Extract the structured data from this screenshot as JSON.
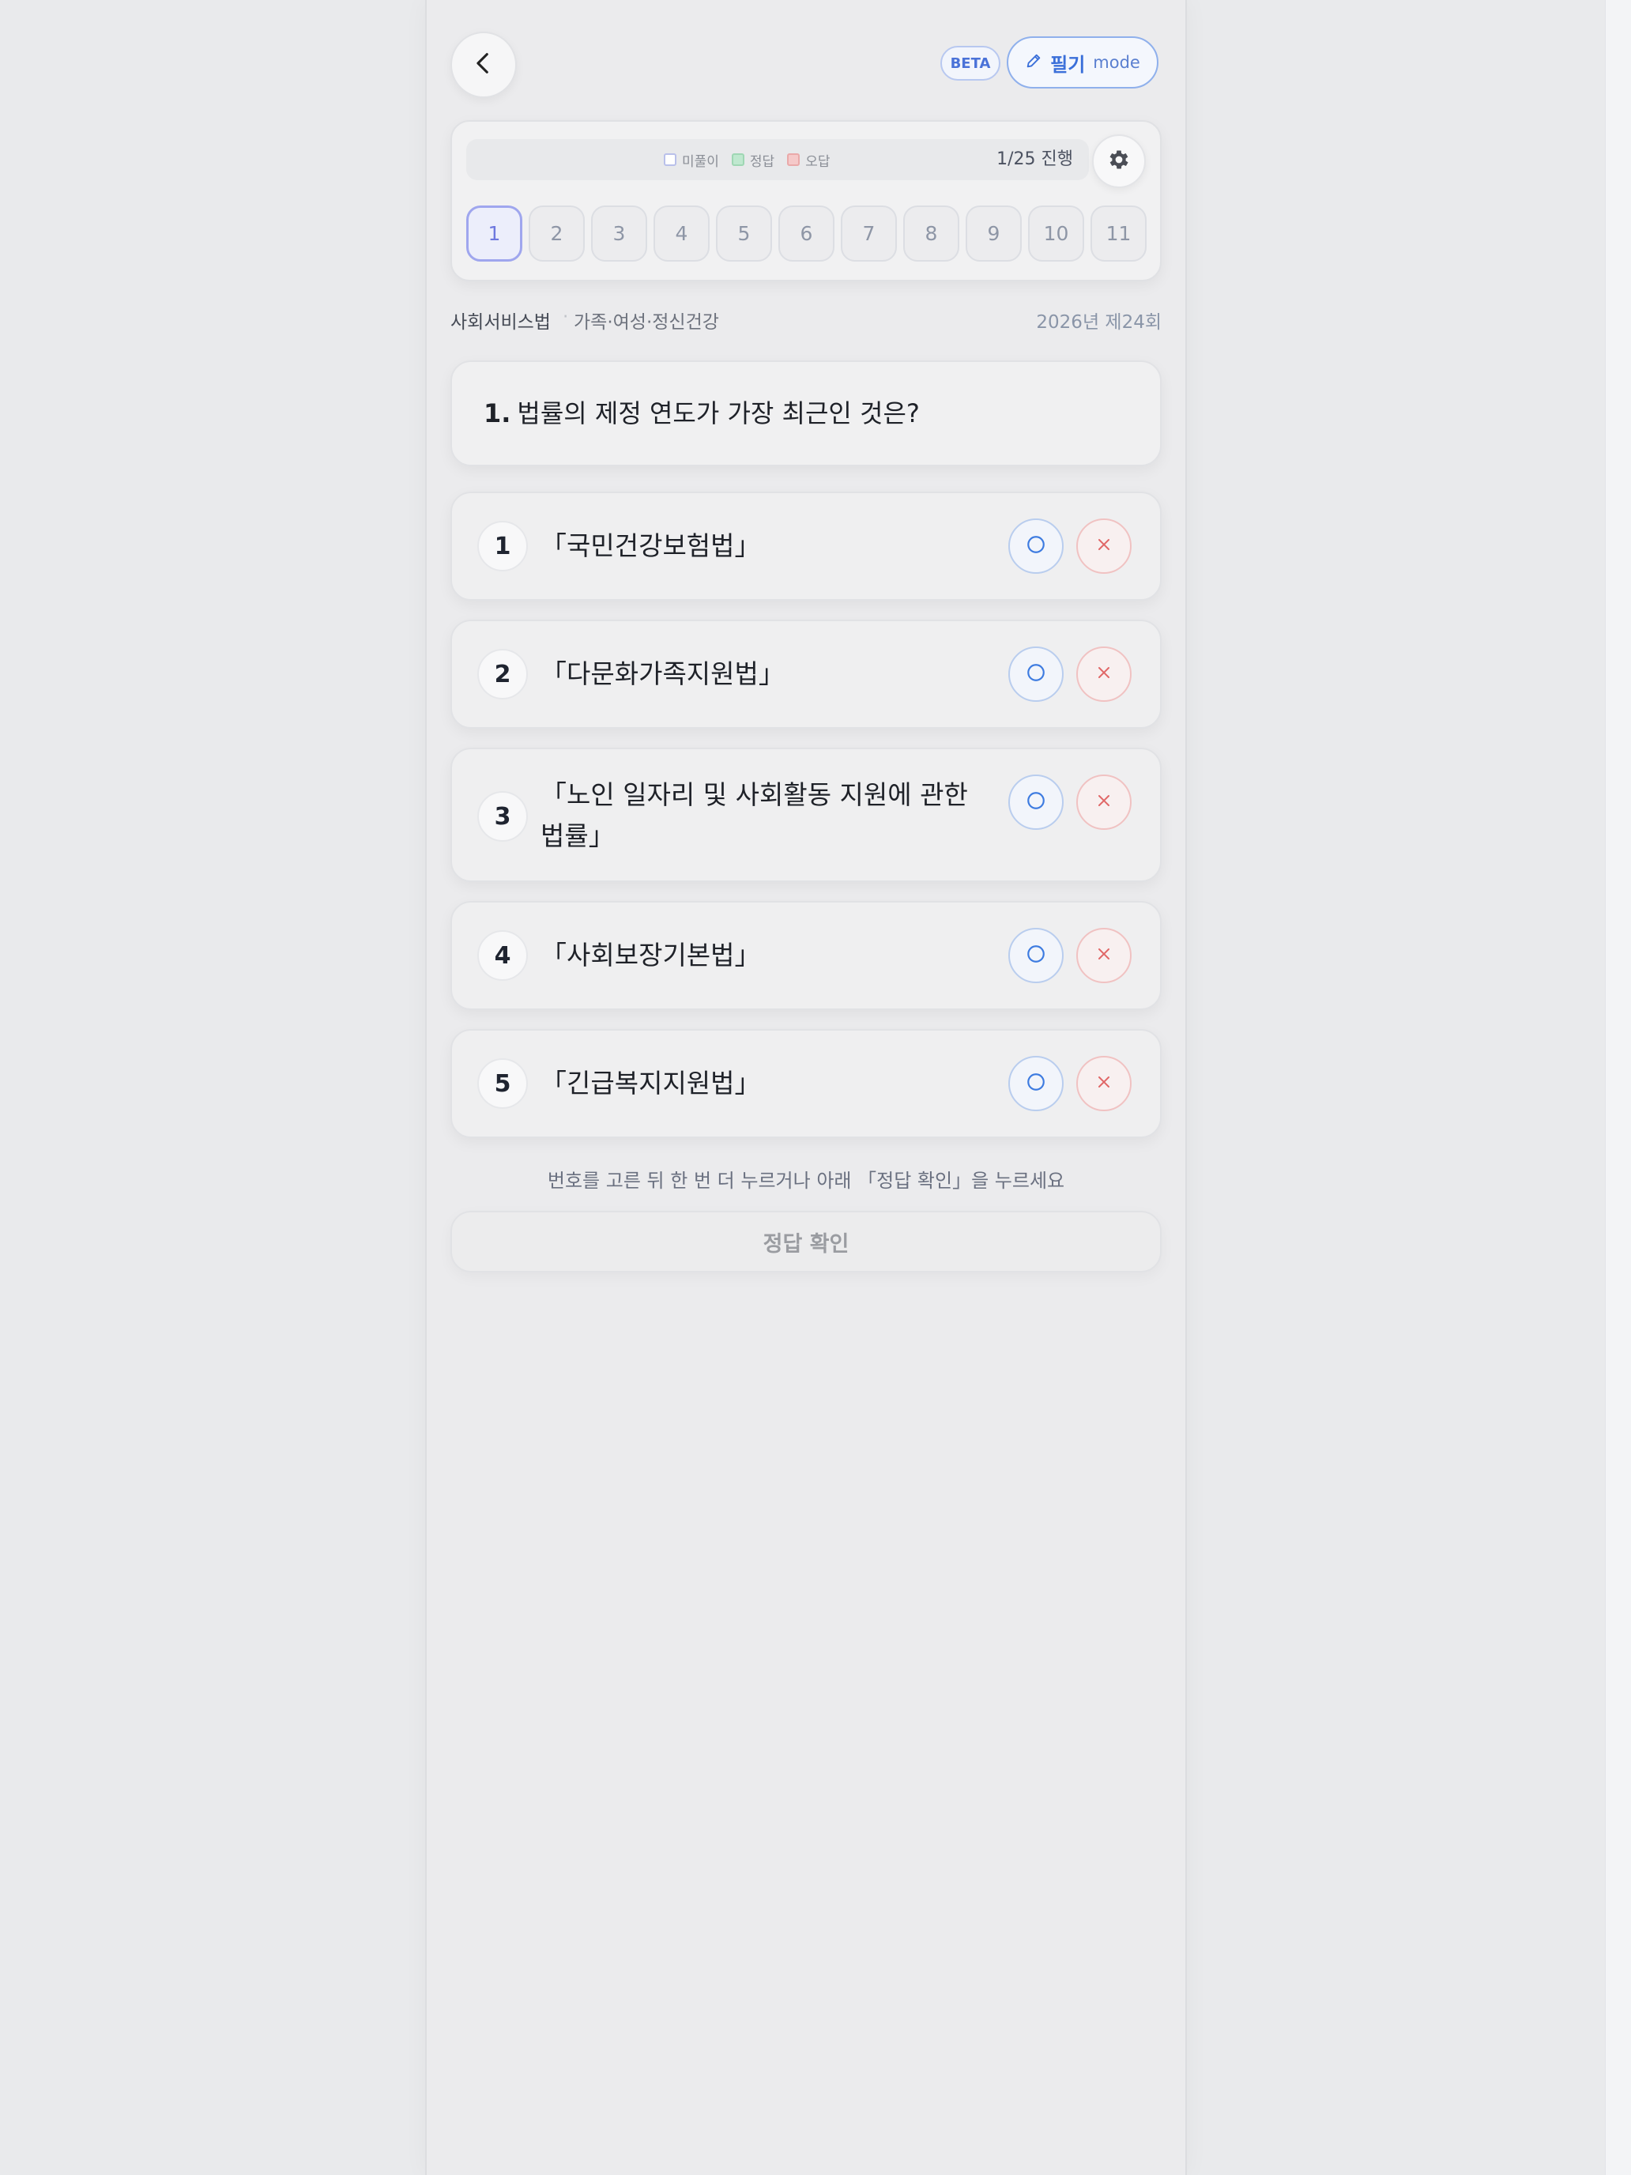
{
  "header": {
    "beta_label": "BETA",
    "mode_label": "필기",
    "mode_suffix": "mode"
  },
  "progress": {
    "legend": [
      {
        "label": "미풀이",
        "color": "#ffffff",
        "border": "#b9c0ea"
      },
      {
        "label": "정답",
        "color": "#bfe8cf",
        "border": "#9fd7b4"
      },
      {
        "label": "오답",
        "color": "#f5c9c9",
        "border": "#eaa9a9"
      }
    ],
    "status_text": "1/25 진행",
    "current": 1,
    "question_numbers": [
      "1",
      "2",
      "3",
      "4",
      "5",
      "6",
      "7",
      "8",
      "9",
      "10",
      "11"
    ]
  },
  "meta": {
    "subject": "사회서비스법",
    "separator": "·",
    "category": "가족·여성·정신건강",
    "exam": "2026년 제24회"
  },
  "question": {
    "number": "1.",
    "text": "법률의 제정 연도가 가장 최근인 것은?"
  },
  "options": [
    {
      "no": "1",
      "text": "「국민건강보험법」"
    },
    {
      "no": "2",
      "text": "「다문화가족지원법」"
    },
    {
      "no": "3",
      "text": "「노인 일자리 및 사회활동 지원에 관한 법률」"
    },
    {
      "no": "4",
      "text": "「사회보장기본법」"
    },
    {
      "no": "5",
      "text": "「긴급복지지원법」"
    }
  ],
  "hint": "번호를 고른 뒤 한 번 더 누르거나 아래 「정답 확인」을 누르세요",
  "submit_label": "정답 확인",
  "colors": {
    "accent_blue": "#3a6fd9",
    "o_mark": "#3d7be0",
    "x_mark": "#e06767",
    "active_qnum": "#6e78de"
  }
}
